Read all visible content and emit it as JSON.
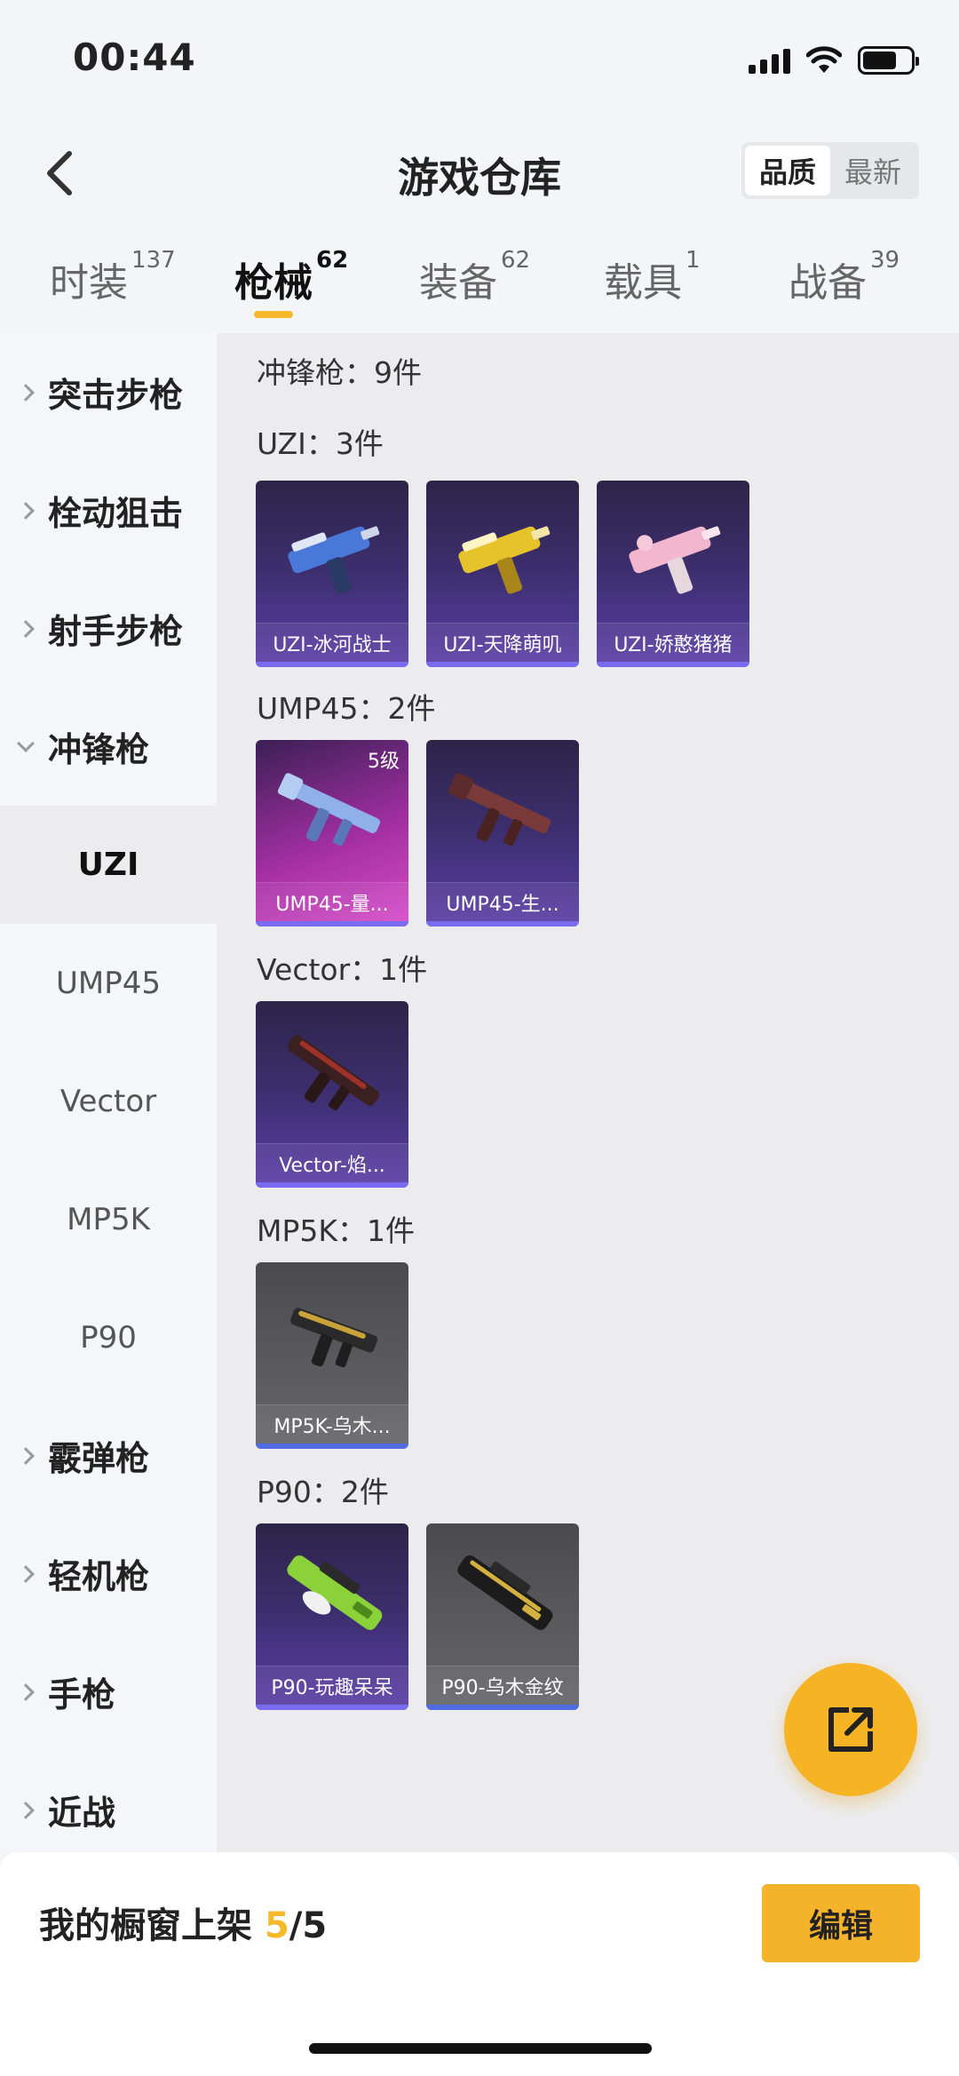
{
  "status": {
    "time": "00:44"
  },
  "header": {
    "title": "游戏仓库",
    "sort_quality": "品质",
    "sort_latest": "最新"
  },
  "tabs": [
    {
      "label": "时装",
      "count": "137"
    },
    {
      "label": "枪械",
      "count": "62"
    },
    {
      "label": "装备",
      "count": "62"
    },
    {
      "label": "载具",
      "count": "1"
    },
    {
      "label": "战备",
      "count": "39"
    }
  ],
  "sidebar": {
    "cat_assault": "突击步枪",
    "cat_bolt": "栓动狙击",
    "cat_marksman": "射手步枪",
    "cat_smg": "冲锋枪",
    "sub_uzi": "UZI",
    "sub_ump45": "UMP45",
    "sub_vector": "Vector",
    "sub_mp5k": "MP5K",
    "sub_p90": "P90",
    "cat_shotgun": "霰弹枪",
    "cat_lmg": "轻机枪",
    "cat_pistol": "手枪",
    "cat_melee": "近战"
  },
  "content": {
    "summary": "冲锋枪：9件",
    "groups": [
      {
        "title": "UZI：3件",
        "items": [
          {
            "label": "UZI-冰河战士",
            "color": "#4a78d8"
          },
          {
            "label": "UZI-天降萌叽",
            "color": "#e6c22b"
          },
          {
            "label": "UZI-娇憨猪猪",
            "color": "#f2b7cf"
          }
        ]
      },
      {
        "title": "UMP45：2件",
        "items": [
          {
            "label": "UMP45-量...",
            "level": "5级",
            "color": "#8fb0e8"
          },
          {
            "label": "UMP45-生...",
            "color": "#7a3a3a"
          }
        ]
      },
      {
        "title": "Vector：1件",
        "items": [
          {
            "label": "Vector-焰...",
            "color": "#a0302a"
          }
        ]
      },
      {
        "title": "MP5K：1件",
        "items": [
          {
            "label": "MP5K-乌木...",
            "color": "#c9a23a"
          }
        ]
      },
      {
        "title": "P90：2件",
        "items": [
          {
            "label": "P90-玩趣呆呆",
            "color": "#8bd13a"
          },
          {
            "label": "P90-乌木金纹",
            "color": "#d4b040"
          }
        ]
      }
    ]
  },
  "bottom": {
    "showcase_label": "我的橱窗上架",
    "showcase_current": "5",
    "showcase_total": "/5",
    "edit_label": "编辑"
  }
}
